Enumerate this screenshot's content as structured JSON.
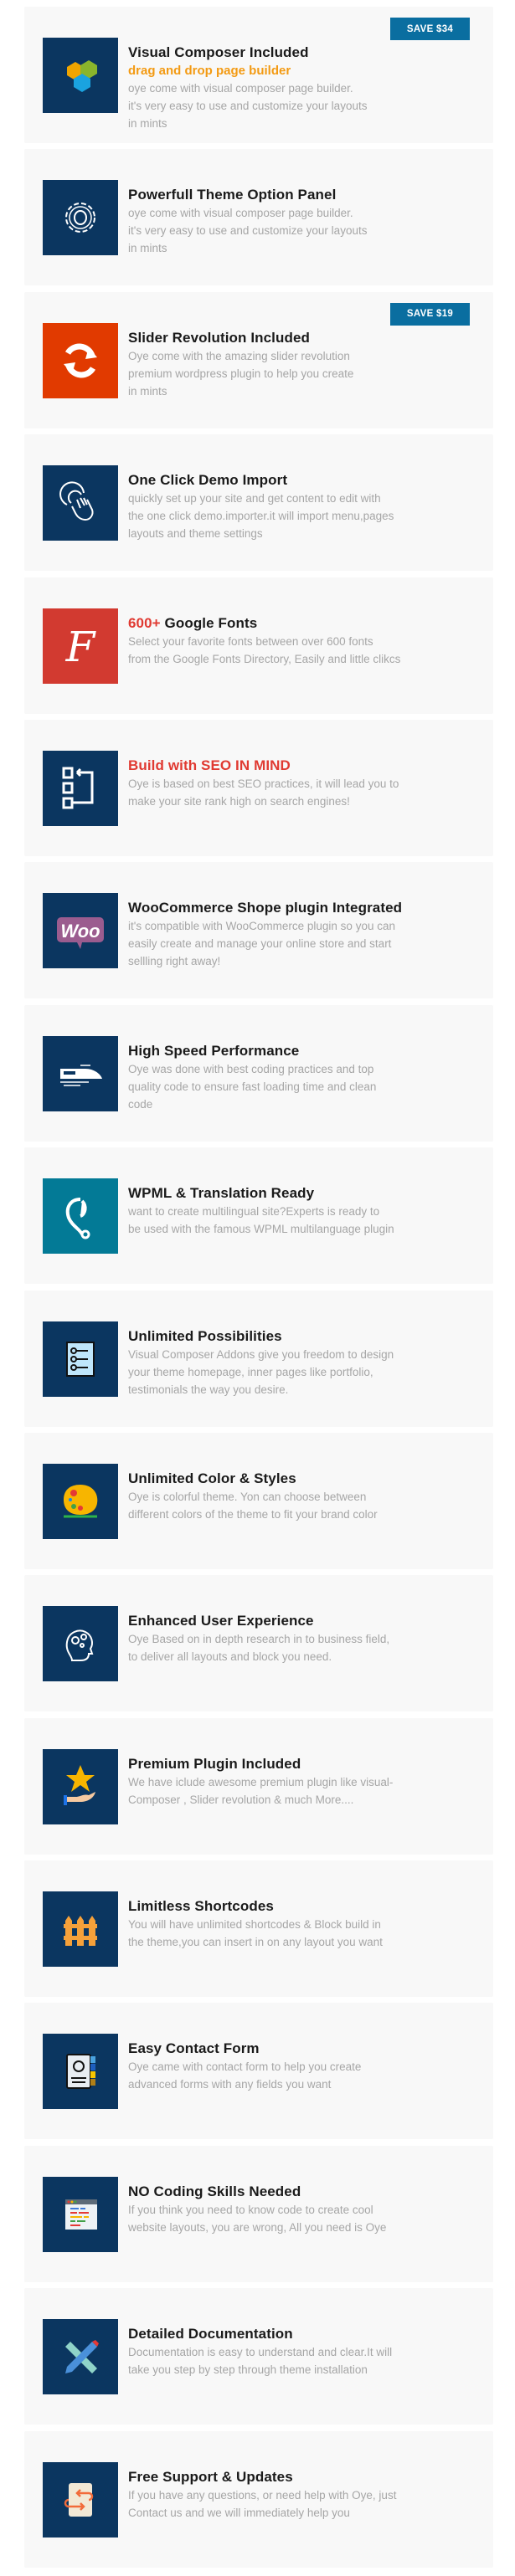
{
  "colors": {
    "navy": "#0b3660",
    "badge": "#0a6ea0",
    "accent_orange": "#f39a12",
    "accent_red": "#e03a32"
  },
  "features": [
    {
      "icon": "visual-composer-icon",
      "bg": "#0b3660",
      "title": "Visual Composer Included",
      "subtitle": "drag and drop page builder",
      "desc": "oye come with visual composer page builder.\n it's very easy to use and customize your layouts\nin mints",
      "badge": "SAVE $34"
    },
    {
      "icon": "gear-icon",
      "bg": "#0b3660",
      "title": "Powerfull Theme Option Panel",
      "desc": "oye come with visual composer page builder.\nit's very easy to use and customize your layouts\nin mints"
    },
    {
      "icon": "refresh-icon",
      "bg": "#e13a00",
      "title": "Slider Revolution Included",
      "desc": "Oye come with the amazing slider revolution\npremium wordpress plugin to help you create\nin mints",
      "badge": "SAVE $19"
    },
    {
      "icon": "hand-click-icon",
      "bg": "#0b3660",
      "title": "One Click Demo Import",
      "desc": "quickly set up your site and get content to edit with\nthe one click demo.importer.it will import menu,pages\nlayouts and theme settings"
    },
    {
      "icon": "font-icon",
      "bg": "#d23a30",
      "title_prefix": "600+",
      "title": " Google Fonts",
      "desc": "Select your favorite fonts between over 600 fonts\nfrom the Google Fonts Directory, Easily and little clikcs"
    },
    {
      "icon": "sitemap-icon",
      "bg": "#0b3660",
      "title_red": true,
      "title": "Build with SEO IN MIND",
      "desc": "Oye is based on best SEO practices, it will lead you to\nmake your site rank high on search engines!"
    },
    {
      "icon": "woo-icon",
      "bg": "#0b3660",
      "title": "WooCommerce Shope plugin Integrated",
      "desc": "it's compatible with WooCommerce plugin so you can\neasily create and manage your online store and start\nsellling right away!"
    },
    {
      "icon": "train-icon",
      "bg": "#0b3660",
      "title": "High Speed Performance",
      "desc": "Oye was done with best coding practices and top\nquality code to ensure fast loading time and clean\n code"
    },
    {
      "icon": "wpml-icon",
      "bg": "#037a96",
      "title": "WPML &  Translation Ready",
      "desc": "want to create multilingual site?Experts is ready  to\nbe used with the famous WPML multilanguage plugin"
    },
    {
      "icon": "list-icon",
      "bg": "#0b3660",
      "title": "Unlimited Possibilities",
      "desc": "Visual Composer Addons give you freedom to design\nyour theme homepage, inner pages like portfolio,\ntestimonials the way you desire."
    },
    {
      "icon": "palette-icon",
      "bg": "#0b3660",
      "title": "Unlimited Color & Styles",
      "desc": "Oye is colorful theme. Yon can choose between\ndifferent colors of the theme to fit your brand color"
    },
    {
      "icon": "head-gears-icon",
      "bg": "#0b3660",
      "title": "Enhanced User Experience",
      "desc": "Oye Based on in depth research in to business field,\nto deliver all layouts and block you need."
    },
    {
      "icon": "star-hand-icon",
      "bg": "#0b3660",
      "title": "Premium Plugin Included",
      "desc": " We have iclude awesome premium plugin like visual-\nComposer , Slider revolution & much More...."
    },
    {
      "icon": "fence-icon",
      "bg": "#0b3660",
      "title": "Limitless Shortcodes",
      "desc": "You will have unlimited shortcodes & Block build in\nthe theme,you can insert in on any layout you want"
    },
    {
      "icon": "contact-book-icon",
      "bg": "#0b3660",
      "title": "Easy Contact Form",
      "desc": "Oye came with contact form to help you create\n advanced forms with any fields you want"
    },
    {
      "icon": "code-window-icon",
      "bg": "#0b3660",
      "title": "NO Coding Skills Needed",
      "desc": "If you think you need to know code to create cool\nwebsite layouts, you are wrong, All you need  is Oye"
    },
    {
      "icon": "pencil-ruler-icon",
      "bg": "#0b3660",
      "title": "Detailed Documentation",
      "desc": "Documentation is easy to understand and clear.It will\ntake you step by step through theme installation"
    },
    {
      "icon": "support-doc-icon",
      "bg": "#0b3660",
      "title": "Free Support & Updates",
      "desc": "If you have any questions, or need help with Oye, just\nContact us and we will immediately help you"
    }
  ]
}
